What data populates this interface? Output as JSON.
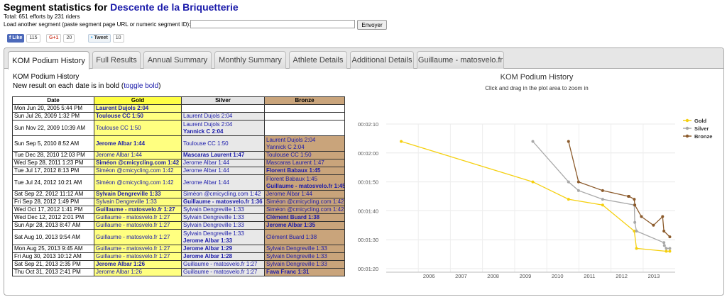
{
  "header": {
    "title_prefix": "Segment statistics for",
    "segment_name": "Descente de la Briquetterie",
    "total": "Total: 651 efforts by 231 riders",
    "load_label": "Load another segment (paste segment page URL or numeric segment ID):",
    "load_input_value": "",
    "load_button": "Envoyer"
  },
  "social": {
    "fb_label": "Like",
    "fb_count": "115",
    "gp_label": "G+1",
    "gp_count": "20",
    "tw_label": "Tweet",
    "tw_count": "10"
  },
  "tabs": [
    "KOM Podium History",
    "Full Results",
    "Annual Summary",
    "Monthly Summary",
    "Athlete Details",
    "Additional Details",
    "Guillaume - matosvelo.fr"
  ],
  "kom": {
    "title": "KOM Podium History",
    "subtitle_prefix": "New result on each date is in bold (",
    "toggle_label": "toggle bold",
    "subtitle_suffix": ")",
    "columns": [
      "Date",
      "Gold",
      "Silver",
      "Bronze"
    ],
    "rows": [
      {
        "date": "Mon Jun 20, 2005 5:44 PM",
        "gold": [
          "Laurent Dujols 2:04"
        ],
        "gold_b": [
          true
        ],
        "silver": [],
        "silver_b": [],
        "bronze": [],
        "bronze_b": []
      },
      {
        "date": "Sun Jul 26, 2009 1:32 PM",
        "gold": [
          "Toulouse CC 1:50"
        ],
        "gold_b": [
          true
        ],
        "silver": [
          "Laurent Dujols 2:04"
        ],
        "silver_b": [
          false
        ],
        "bronze": [],
        "bronze_b": []
      },
      {
        "date": "Sun Nov 22, 2009 10:39 AM",
        "gold": [
          "Toulouse CC 1:50"
        ],
        "gold_b": [
          false
        ],
        "silver": [
          "Laurent Dujols 2:04",
          "Yannick C 2:04"
        ],
        "silver_b": [
          false,
          true
        ],
        "bronze": [],
        "bronze_b": []
      },
      {
        "date": "Sun Sep 5, 2010 8:52 AM",
        "gold": [
          "Jerome Albar 1:44"
        ],
        "gold_b": [
          true
        ],
        "silver": [
          "Toulouse CC 1:50"
        ],
        "silver_b": [
          false
        ],
        "bronze": [
          "Laurent Dujols 2:04",
          "Yannick C 2:04"
        ],
        "bronze_b": [
          false,
          false
        ]
      },
      {
        "date": "Tue Dec 28, 2010 12:03 PM",
        "gold": [
          "Jerome Albar 1:44"
        ],
        "gold_b": [
          false
        ],
        "silver": [
          "Mascaras Laurent 1:47"
        ],
        "silver_b": [
          true
        ],
        "bronze": [
          "Toulouse CC 1:50"
        ],
        "bronze_b": [
          false
        ]
      },
      {
        "date": "Wed Sep 28, 2011 1:23 PM",
        "gold": [
          "Siméon @cmicycling.com 1:42"
        ],
        "gold_b": [
          true
        ],
        "silver": [
          "Jerome Albar 1:44"
        ],
        "silver_b": [
          false
        ],
        "bronze": [
          "Mascaras Laurent 1:47"
        ],
        "bronze_b": [
          false
        ]
      },
      {
        "date": "Tue Jul 17, 2012 8:13 PM",
        "gold": [
          "Siméon @cmicycling.com 1:42"
        ],
        "gold_b": [
          false
        ],
        "silver": [
          "Jerome Albar 1:44"
        ],
        "silver_b": [
          false
        ],
        "bronze": [
          "Florent Babaux 1:45"
        ],
        "bronze_b": [
          true
        ]
      },
      {
        "date": "Tue Jul 24, 2012 10:21 AM",
        "gold": [
          "Siméon @cmicycling.com 1:42"
        ],
        "gold_b": [
          false
        ],
        "silver": [
          "Jerome Albar 1:44"
        ],
        "silver_b": [
          false
        ],
        "bronze": [
          "Florent Babaux 1:45",
          "Guillaume - matosvelo.fr 1:45"
        ],
        "bronze_b": [
          false,
          true
        ]
      },
      {
        "date": "Sat Sep 22, 2012 11:12 AM",
        "gold": [
          "Sylvain Dengreville 1:33"
        ],
        "gold_b": [
          true
        ],
        "silver": [
          "Siméon @cmicycling.com 1:42"
        ],
        "silver_b": [
          false
        ],
        "bronze": [
          "Jerome Albar 1:44"
        ],
        "bronze_b": [
          false
        ]
      },
      {
        "date": "Fri Sep 28, 2012 1:49 PM",
        "gold": [
          "Sylvain Dengreville 1:33"
        ],
        "gold_b": [
          false
        ],
        "silver": [
          "Guillaume - matosvelo.fr 1:36"
        ],
        "silver_b": [
          true
        ],
        "bronze": [
          "Siméon @cmicycling.com 1:42"
        ],
        "bronze_b": [
          false
        ]
      },
      {
        "date": "Wed Oct 17, 2012 1:41 PM",
        "gold": [
          "Guillaume - matosvelo.fr 1:27"
        ],
        "gold_b": [
          true
        ],
        "silver": [
          "Sylvain Dengreville 1:33"
        ],
        "silver_b": [
          false
        ],
        "bronze": [
          "Siméon @cmicycling.com 1:42"
        ],
        "bronze_b": [
          false
        ]
      },
      {
        "date": "Wed Dec 12, 2012 2:01 PM",
        "gold": [
          "Guillaume - matosvelo.fr 1:27"
        ],
        "gold_b": [
          false
        ],
        "silver": [
          "Sylvain Dengreville 1:33"
        ],
        "silver_b": [
          false
        ],
        "bronze": [
          "Clément Buard 1:38"
        ],
        "bronze_b": [
          true
        ]
      },
      {
        "date": "Sun Apr 28, 2013 8:47 AM",
        "gold": [
          "Guillaume - matosvelo.fr 1:27"
        ],
        "gold_b": [
          false
        ],
        "silver": [
          "Sylvain Dengreville 1:33"
        ],
        "silver_b": [
          false
        ],
        "bronze": [
          "Jerome Albar 1:35"
        ],
        "bronze_b": [
          true
        ]
      },
      {
        "date": "Sat Aug 10, 2013 9:54 AM",
        "gold": [
          "Guillaume - matosvelo.fr 1:27"
        ],
        "gold_b": [
          false
        ],
        "silver": [
          "Sylvain Dengreville 1:33",
          "Jerome Albar 1:33"
        ],
        "silver_b": [
          false,
          true
        ],
        "bronze": [
          "Clément Buard 1:38"
        ],
        "bronze_b": [
          false
        ]
      },
      {
        "date": "Mon Aug 25, 2013 9:45 AM",
        "gold": [
          "Guillaume - matosvelo.fr 1:27"
        ],
        "gold_b": [
          false
        ],
        "silver": [
          "Jerome Albar 1:29"
        ],
        "silver_b": [
          true
        ],
        "bronze": [
          "Sylvain Dengreville 1:33"
        ],
        "bronze_b": [
          false
        ]
      },
      {
        "date": "Fri Aug 30, 2013 10:12 AM",
        "gold": [
          "Guillaume - matosvelo.fr 1:27"
        ],
        "gold_b": [
          false
        ],
        "silver": [
          "Jerome Albar 1:28"
        ],
        "silver_b": [
          true
        ],
        "bronze": [
          "Sylvain Dengreville 1:33"
        ],
        "bronze_b": [
          false
        ]
      },
      {
        "date": "Sat Sep 21, 2013 2:35 PM",
        "gold": [
          "Jerome Albar 1:26"
        ],
        "gold_b": [
          true
        ],
        "silver": [
          "Guillaume - matosvelo.fr 1:27"
        ],
        "silver_b": [
          false
        ],
        "bronze": [
          "Sylvain Dengreville 1:33"
        ],
        "bronze_b": [
          false
        ]
      },
      {
        "date": "Thu Oct 31, 2013 2:41 PM",
        "gold": [
          "Jerome Albar 1:26"
        ],
        "gold_b": [
          false
        ],
        "silver": [
          "Guillaume - matosvelo.fr 1:27"
        ],
        "silver_b": [
          false
        ],
        "bronze": [
          "Fava Franc 1:31"
        ],
        "bronze_b": [
          true
        ]
      }
    ]
  },
  "chart_data": {
    "type": "line",
    "title": "KOM Podium History",
    "subtitle": "Click and drag in the plot area to zoom in",
    "x_ticks": [
      "2006",
      "2007",
      "2008",
      "2009",
      "2010",
      "2011",
      "2012",
      "2013"
    ],
    "y_ticks": [
      "00:02:10",
      "00:02:00",
      "00:01:50",
      "00:01:40",
      "00:01:30",
      "00:01:20"
    ],
    "ylim": [
      80,
      130
    ],
    "xlim": [
      "2005-01-01",
      "2013-12-31"
    ],
    "grid": true,
    "legend_position": "right",
    "series": [
      {
        "name": "Gold",
        "color": "#f5d010",
        "points": [
          [
            "2005-06-20",
            124
          ],
          [
            "2009-07-26",
            110
          ],
          [
            "2010-09-05",
            104
          ],
          [
            "2011-09-28",
            102
          ],
          [
            "2012-09-22",
            93
          ],
          [
            "2012-10-17",
            87
          ],
          [
            "2013-09-21",
            86
          ],
          [
            "2013-10-31",
            86
          ]
        ]
      },
      {
        "name": "Silver",
        "color": "#a8a8a8",
        "points": [
          [
            "2009-07-26",
            124
          ],
          [
            "2010-09-05",
            110
          ],
          [
            "2010-12-28",
            107
          ],
          [
            "2011-09-28",
            104
          ],
          [
            "2012-09-22",
            102
          ],
          [
            "2012-09-28",
            96
          ],
          [
            "2012-10-17",
            93
          ],
          [
            "2013-08-25",
            89
          ],
          [
            "2013-08-30",
            88
          ],
          [
            "2013-09-21",
            87
          ],
          [
            "2013-10-31",
            87
          ]
        ]
      },
      {
        "name": "Bronze",
        "color": "#8b5a2b",
        "points": [
          [
            "2010-09-05",
            124
          ],
          [
            "2010-12-28",
            110
          ],
          [
            "2011-09-28",
            107
          ],
          [
            "2012-07-17",
            105
          ],
          [
            "2012-07-24",
            105
          ],
          [
            "2012-09-22",
            104
          ],
          [
            "2012-09-28",
            102
          ],
          [
            "2012-12-12",
            98
          ],
          [
            "2013-04-28",
            95
          ],
          [
            "2013-08-10",
            98
          ],
          [
            "2013-08-25",
            93
          ],
          [
            "2013-10-31",
            91
          ]
        ]
      }
    ]
  }
}
